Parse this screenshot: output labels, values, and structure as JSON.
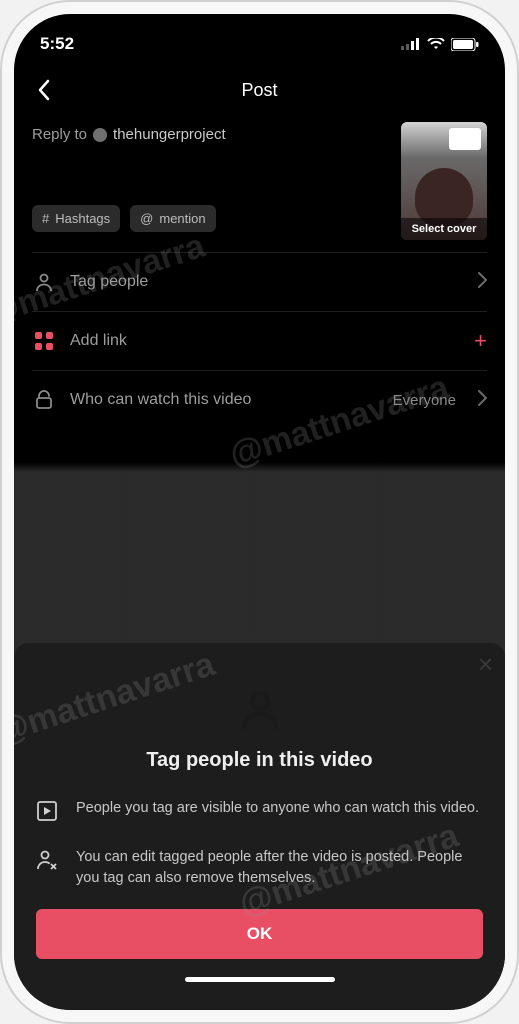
{
  "watermark": "@mattnavarra",
  "statusbar": {
    "time": "5:52"
  },
  "nav": {
    "title": "Post"
  },
  "caption": {
    "reply_prefix": "Reply to",
    "reply_user": "thehungerproject"
  },
  "chips": {
    "hashtags": "Hashtags",
    "mention": "mention"
  },
  "cover": {
    "label": "Select cover"
  },
  "rows": {
    "tag": {
      "label": "Tag people"
    },
    "link": {
      "label": "Add link"
    },
    "privacy": {
      "label": "Who can watch this video",
      "value": "Everyone"
    }
  },
  "sheet": {
    "title": "Tag people in this video",
    "bullet1": "People you tag are visible to anyone who can watch this video.",
    "bullet2": "You can edit tagged people after the video is posted. People you tag can also remove themselves.",
    "ok": "OK"
  }
}
